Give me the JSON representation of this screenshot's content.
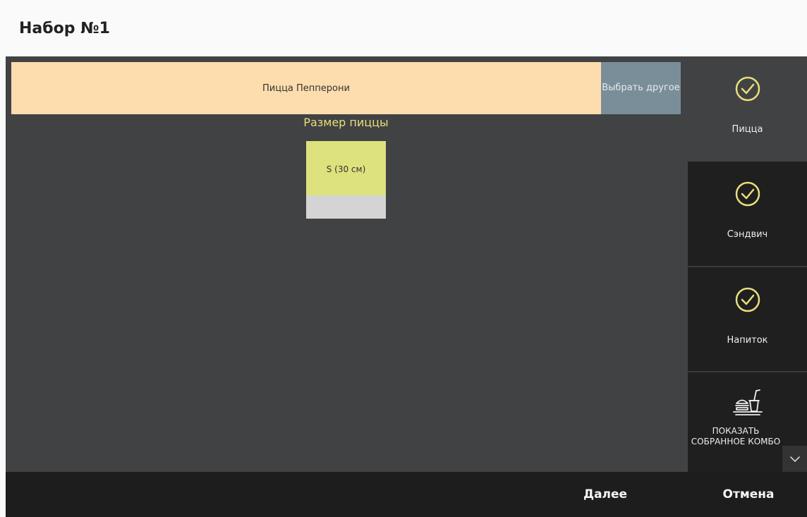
{
  "header": {
    "title": "Набор №1"
  },
  "product": {
    "name": "Пицца Пепперони",
    "choose_other": "Выбрать другое"
  },
  "size_section": {
    "title": "Размер пиццы",
    "options": [
      {
        "label": "S (30 см)",
        "selected": true
      }
    ]
  },
  "sidebar": {
    "tabs": [
      {
        "label": "Пицца",
        "icon": "check-circle-icon",
        "active": true
      },
      {
        "label": "Сэндвич",
        "icon": "check-circle-icon",
        "active": false
      },
      {
        "label": "Напиток",
        "icon": "check-circle-icon",
        "active": false
      }
    ],
    "combo": {
      "label": "ПОКАЗАТЬ СОБРАННОЕ КОМБО",
      "icon": "combo-tray-icon"
    }
  },
  "footer": {
    "next": "Далее",
    "cancel": "Отмена"
  },
  "colors": {
    "accent_yellow": "#e9de7c",
    "product_bar": "#fddcad",
    "choose_other_bg": "#7a8e99",
    "size_selected": "#dde27c",
    "panel_bg": "#414243",
    "tab_bg": "#1f1f1f"
  }
}
